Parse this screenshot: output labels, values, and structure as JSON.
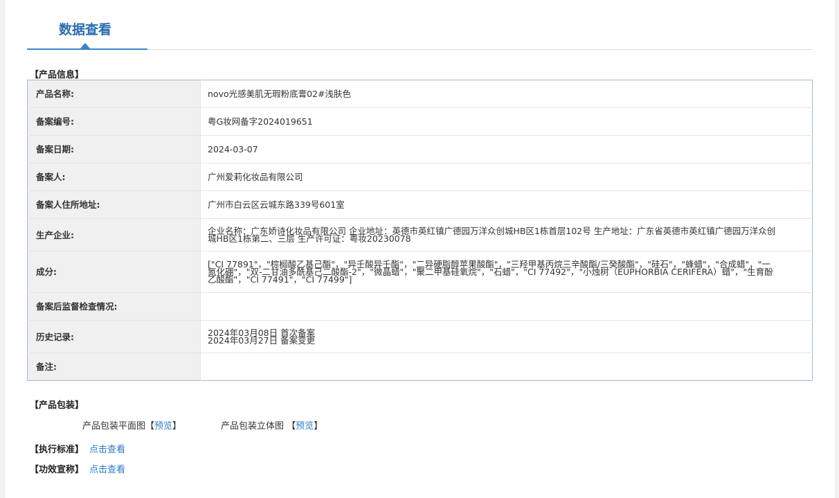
{
  "tab": {
    "label": "数据查看"
  },
  "product_info": {
    "section_title": "【产品信息】",
    "rows": [
      {
        "label": "产品名称:",
        "value": "novo光感美肌无瑕粉底膏02#浅肤色"
      },
      {
        "label": "备案编号:",
        "value": "粤G妆网备字2024019651"
      },
      {
        "label": "备案日期:",
        "value": "2024-03-07"
      },
      {
        "label": "备案人:",
        "value": "广州爱莉化妆品有限公司"
      },
      {
        "label": "备案人住所地址:",
        "value": "广州市白云区云城东路339号601室"
      },
      {
        "label": "生产企业:",
        "value": "企业名称：广东娇诗化妆品有限公司 企业地址：英德市英红镇广德园万洋众创城HB区1栋首层102号 生产地址：广东省英德市英红镇广德园万洋众创城HB区1栋第二、三层 生产许可证：粤妆20230078"
      },
      {
        "label": "成分:",
        "value": "[\"CI 77891\"，\"棕榈酸乙基己酯\"，\"异壬酸异壬酯\"，\"二异硬脂醇苹果酸酯\"，\"三羟甲基丙烷三辛酸酯/三癸酸酯\"，\"硅石\"，\"蜂蜡\"，\"合成蜡\"，\"一氮化硼\"，\"双-二甘油多酰基己二酸酯-2\"，\"微晶蜡\"，\"聚二甲基硅氧烷\"，\"石蜡\"，\"CI 77492\"，\"小烛树（EUPHORBIA CERIFERA）蜡\"，\"生育酚乙酸酯\"，\"CI 77491\"，\"CI 77499\"]"
      },
      {
        "label": "备案后监督检查情况:",
        "value": ""
      },
      {
        "label": "历史记录:",
        "lines": [
          "2024年03月08日 首次备案",
          "2024年03月27日 备案变更"
        ]
      },
      {
        "label": "备注:",
        "value": ""
      }
    ]
  },
  "packaging": {
    "section_title": "【产品包装】",
    "flat_label": "产品包装平面图",
    "solid_label": "产品包装立体图",
    "preview_link": "预览",
    "bracket_open": "【",
    "bracket_close": "】"
  },
  "standard": {
    "title": "【执行标准】",
    "link": "点击查看"
  },
  "efficacy": {
    "title": "【功效宣称】",
    "link": "点击查看"
  }
}
